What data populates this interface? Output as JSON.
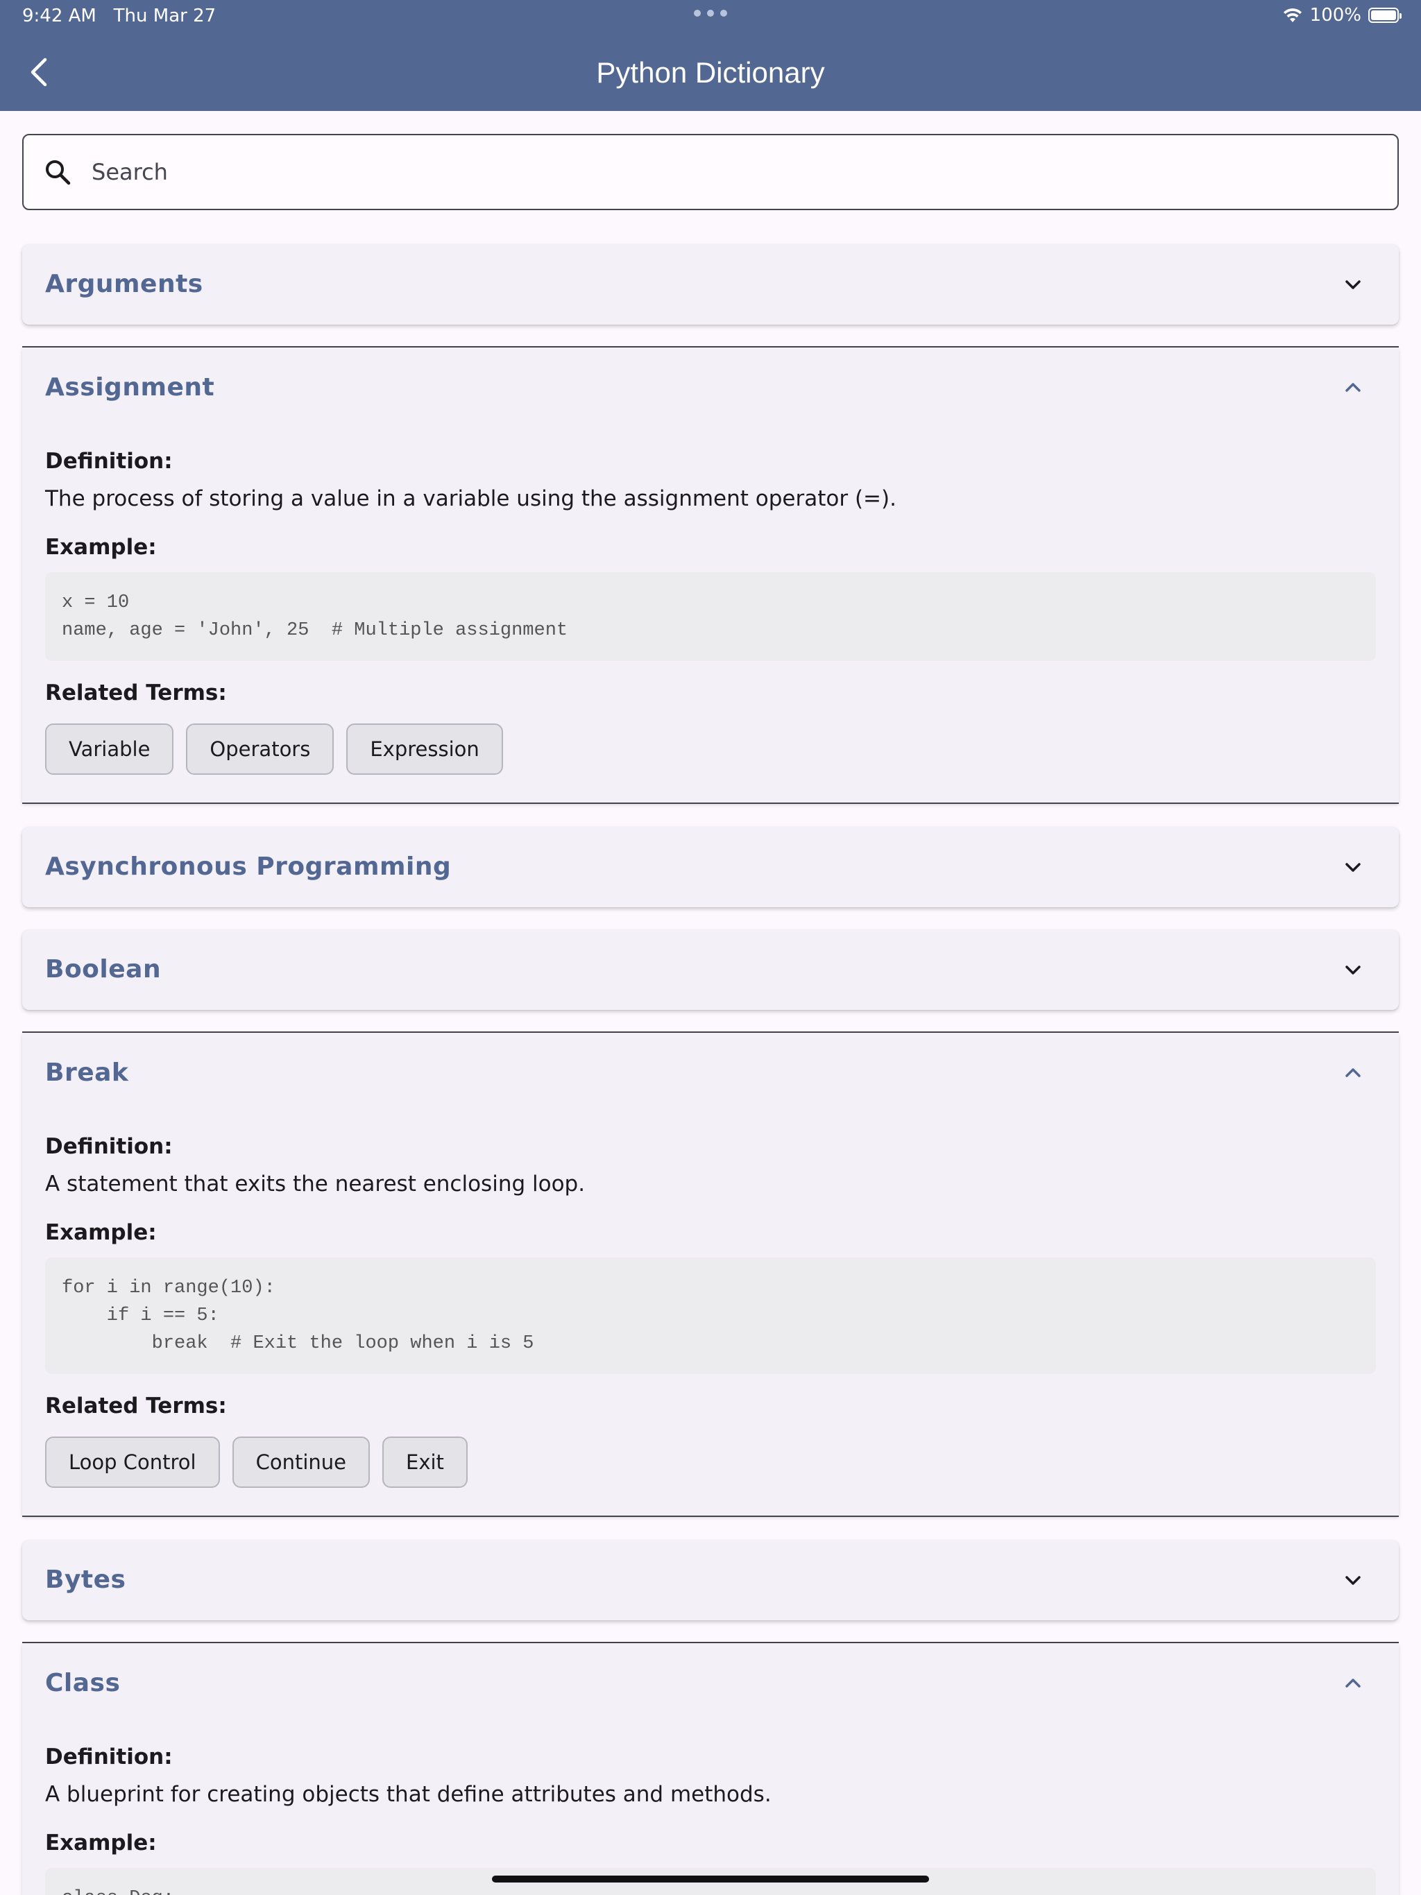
{
  "status": {
    "time": "9:42 AM",
    "date": "Thu Mar 27",
    "battery": "100%"
  },
  "header": {
    "title": "Python Dictionary"
  },
  "search": {
    "placeholder": "Search"
  },
  "labels": {
    "definition": "Definition:",
    "example": "Example:",
    "related": "Related Terms:"
  },
  "terms": [
    {
      "title": "Arguments"
    },
    {
      "title": "Assignment",
      "definition": "The process of storing a value in a variable using the assignment operator (=).",
      "example": "x = 10\nname, age = 'John', 25  # Multiple assignment",
      "related": [
        "Variable",
        "Operators",
        "Expression"
      ]
    },
    {
      "title": "Asynchronous Programming"
    },
    {
      "title": "Boolean"
    },
    {
      "title": "Break",
      "definition": "A statement that exits the nearest enclosing loop.",
      "example": "for i in range(10):\n    if i == 5:\n        break  # Exit the loop when i is 5",
      "related": [
        "Loop Control",
        "Continue",
        "Exit"
      ]
    },
    {
      "title": "Bytes"
    },
    {
      "title": "Class",
      "definition": "A blueprint for creating objects that define attributes and methods.",
      "example": "class Dog:"
    }
  ]
}
